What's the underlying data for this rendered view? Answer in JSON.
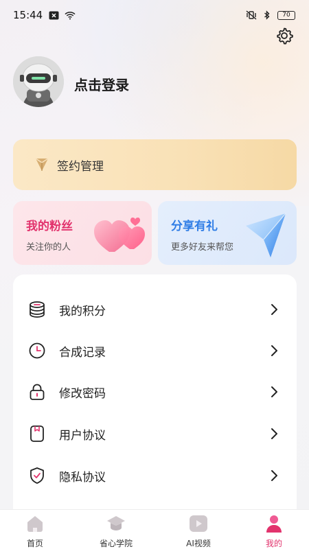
{
  "status_bar": {
    "time": "15:44",
    "battery": "70",
    "icons": [
      "close-box-icon",
      "wifi-icon",
      "mute-vibrate-icon",
      "bluetooth-icon",
      "battery-icon"
    ]
  },
  "header": {
    "settings_icon": "gear-icon"
  },
  "profile": {
    "login_label": "点击登录",
    "avatar_icon": "robot-avatar-icon"
  },
  "contract": {
    "label": "签约管理",
    "icon": "diamond-icon",
    "colors": {
      "bg_start": "#fbe8c6",
      "bg_end": "#f6d9a5",
      "icon": "#c9a06a"
    }
  },
  "fans": {
    "title": "我的粉丝",
    "subtitle": "关注你的人",
    "icon": "hearts-icon",
    "colors": {
      "title": "#e2336d",
      "bg": "#fde6ea"
    }
  },
  "share": {
    "title": "分享有礼",
    "subtitle": "更多好友来帮您",
    "icon": "paper-plane-icon",
    "colors": {
      "title": "#2f7de6",
      "bg": "#e4eefc"
    }
  },
  "menu": {
    "items": [
      {
        "label": "我的积分",
        "icon": "coins-stack-icon"
      },
      {
        "label": "合成记录",
        "icon": "clock-icon"
      },
      {
        "label": "修改密码",
        "icon": "lock-icon"
      },
      {
        "label": "用户协议",
        "icon": "document-bookmark-icon"
      },
      {
        "label": "隐私协议",
        "icon": "shield-check-icon"
      }
    ]
  },
  "bottom_nav": {
    "items": [
      {
        "label": "首页",
        "icon": "home-icon",
        "active": false
      },
      {
        "label": "省心学院",
        "icon": "graduation-cap-icon",
        "active": false
      },
      {
        "label": "AI视频",
        "icon": "play-icon",
        "active": false
      },
      {
        "label": "我的",
        "icon": "user-icon",
        "active": true
      }
    ],
    "active_color": "#e2336d"
  }
}
